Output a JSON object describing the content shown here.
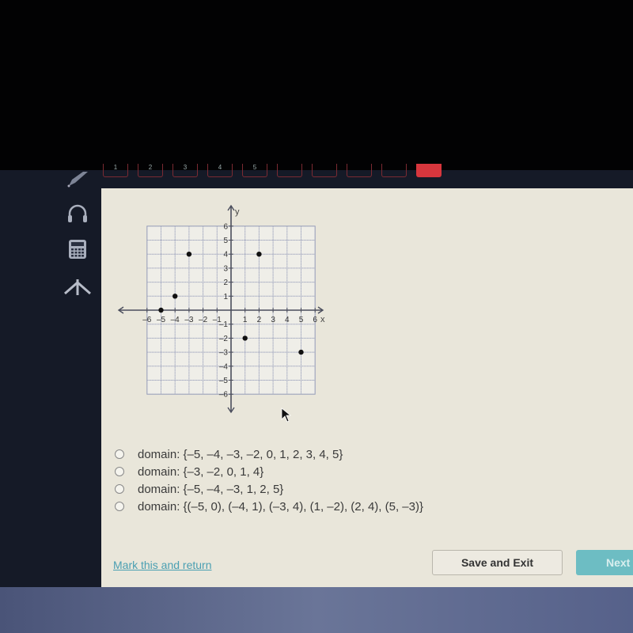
{
  "question_nav": {
    "items": [
      "1",
      "2",
      "3",
      "4",
      "5",
      "",
      "",
      "",
      "",
      ""
    ],
    "current_index": 9,
    "border_color": "#7b2a32",
    "current_color": "#d7363d"
  },
  "sidebar": {
    "tools": [
      {
        "name": "pencil-icon"
      },
      {
        "name": "headphones-icon"
      },
      {
        "name": "calculator-icon"
      },
      {
        "name": "reference-icon"
      }
    ]
  },
  "chart_data": {
    "type": "scatter",
    "title": "",
    "xlabel": "x",
    "ylabel": "y",
    "xlim": [
      -6,
      6
    ],
    "ylim": [
      -6,
      6
    ],
    "grid": true,
    "x_ticks": [
      "-6",
      "-5",
      "-4",
      "-3",
      "-2",
      "-1",
      "1",
      "2",
      "3",
      "4",
      "5",
      "6"
    ],
    "y_ticks": [
      "6",
      "5",
      "4",
      "3",
      "2",
      "1",
      "-1",
      "-2",
      "-3",
      "-4",
      "-5",
      "-6"
    ],
    "points": [
      {
        "x": -5,
        "y": 0
      },
      {
        "x": -4,
        "y": 1
      },
      {
        "x": -3,
        "y": 4
      },
      {
        "x": 1,
        "y": -2
      },
      {
        "x": 2,
        "y": 4
      },
      {
        "x": 5,
        "y": -3
      }
    ]
  },
  "choices": [
    {
      "label": "domain: {–5, –4, –3, –2, 0, 1, 2, 3, 4, 5}",
      "selected": false
    },
    {
      "label": "domain: {–3, –2, 0, 1, 4}",
      "selected": false
    },
    {
      "label": "domain: {–5, –4, –3, 1, 2, 5}",
      "selected": false
    },
    {
      "label": "domain: {(–5, 0), (–4, 1), (–3, 4), (1, –2), (2, 4), (5, –3)}",
      "selected": false
    }
  ],
  "footer": {
    "mark_link": "Mark this and return",
    "save_exit": "Save and Exit",
    "next": "Next"
  },
  "colors": {
    "panel_bg": "#e9e6da",
    "link": "#4a9fb2",
    "next_button": "#6dbdc3"
  }
}
